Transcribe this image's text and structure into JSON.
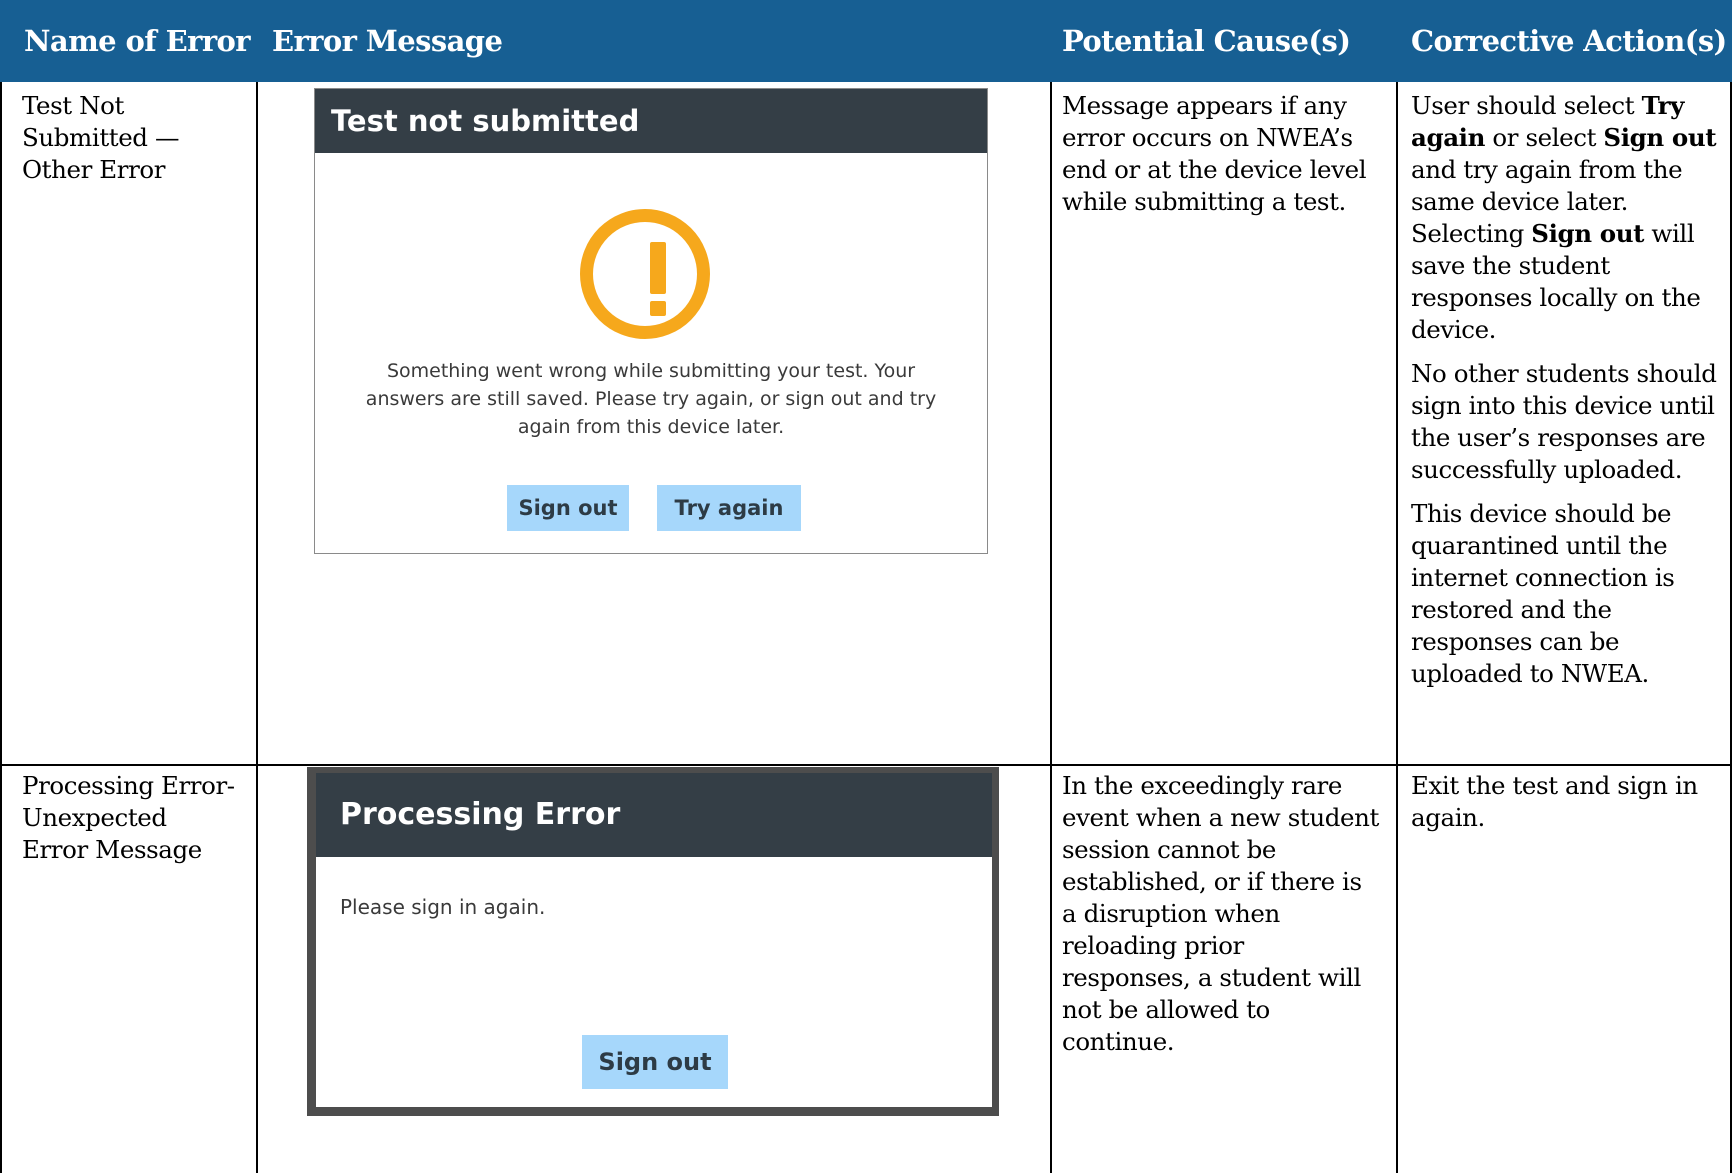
{
  "headers": {
    "name": "Name of Error",
    "message": "Error Message",
    "cause": "Potential Cause(s)",
    "action": "Corrective Action(s)"
  },
  "rows": [
    {
      "name": [
        "Test Not",
        "Submitted —",
        "Other Error"
      ],
      "dialog": {
        "title": "Test not submitted",
        "icon": "warning-circle-icon",
        "message_lines": [
          "Something went wrong while submitting your test. Your",
          "answers are still saved. Please try again, or sign out and try",
          "again from this device later."
        ],
        "buttons": [
          "Sign out",
          "Try again"
        ]
      },
      "cause": [
        "Message appears if any",
        "error occurs on NWEA’s",
        "end or at the device level",
        "while submitting a test."
      ],
      "action": {
        "p1": {
          "t1": "User should select ",
          "b1": "Try again",
          "t2": " or select ",
          "b2": "Sign out",
          "t3": " and try again from the same device later. Selecting ",
          "b3": "Sign out",
          "t4": " will save the student responses locally on the device."
        },
        "p2": "No other students should sign into this device until the user’s responses are successfully uploaded.",
        "p3": "This device should be quarantined until the internet connection is restored and the responses can be uploaded to NWEA."
      }
    },
    {
      "name": [
        "Processing Error-",
        "Unexpected",
        "Error Message"
      ],
      "dialog": {
        "title": "Processing Error",
        "message": "Please sign in again.",
        "button": "Sign out"
      },
      "cause": [
        "In the exceedingly rare",
        "event when a new student",
        "session cannot be",
        "established, or if there is",
        "a disruption when",
        "reloading prior",
        "responses, a student will",
        "not be allowed to",
        "continue."
      ],
      "action": [
        "Exit the test and sign in",
        "again."
      ]
    }
  ],
  "colors": {
    "header_bg": "#175f93",
    "dialog_title_bg": "#343e46",
    "warning": "#f6a81c",
    "button_bg": "#a6d7fb"
  }
}
